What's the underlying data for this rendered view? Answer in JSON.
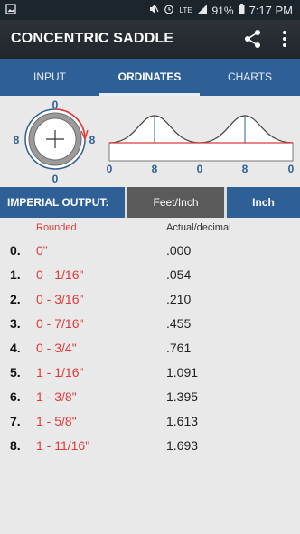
{
  "status": {
    "time": "7:17 PM",
    "battery": "91%",
    "network": "LTE"
  },
  "appbar": {
    "title": "CONCENTRIC SADDLE"
  },
  "tabs": [
    {
      "label": "INPUT"
    },
    {
      "label": "ORDINATES"
    },
    {
      "label": "CHARTS"
    }
  ],
  "circle": {
    "top": "0",
    "bottom": "0",
    "left": "8",
    "right": "8"
  },
  "profile_labels": [
    "0",
    "8",
    "0",
    "8",
    "0"
  ],
  "output": {
    "label": "IMPERIAL OUTPUT:",
    "feet_inch": "Feet/Inch",
    "inch": "Inch"
  },
  "columns": {
    "rounded": "Rounded",
    "actual": "Actual/decimal"
  },
  "rows": [
    {
      "idx": "0.",
      "rounded": "0\"",
      "actual": ".000"
    },
    {
      "idx": "1.",
      "rounded": "0 - 1/16\"",
      "actual": ".054"
    },
    {
      "idx": "2.",
      "rounded": "0 - 3/16\"",
      "actual": ".210"
    },
    {
      "idx": "3.",
      "rounded": "0 - 7/16\"",
      "actual": ".455"
    },
    {
      "idx": "4.",
      "rounded": "0 - 3/4\"",
      "actual": ".761"
    },
    {
      "idx": "5.",
      "rounded": "1 - 1/16\"",
      "actual": "1.091"
    },
    {
      "idx": "6.",
      "rounded": "1 - 3/8\"",
      "actual": "1.395"
    },
    {
      "idx": "7.",
      "rounded": "1 - 5/8\"",
      "actual": "1.613"
    },
    {
      "idx": "8.",
      "rounded": "1 - 11/16\"",
      "actual": "1.693"
    }
  ],
  "colors": {
    "accent_blue": "#2e5f97",
    "red": "#e23a3a",
    "selected_gray": "#5a5a5a"
  }
}
